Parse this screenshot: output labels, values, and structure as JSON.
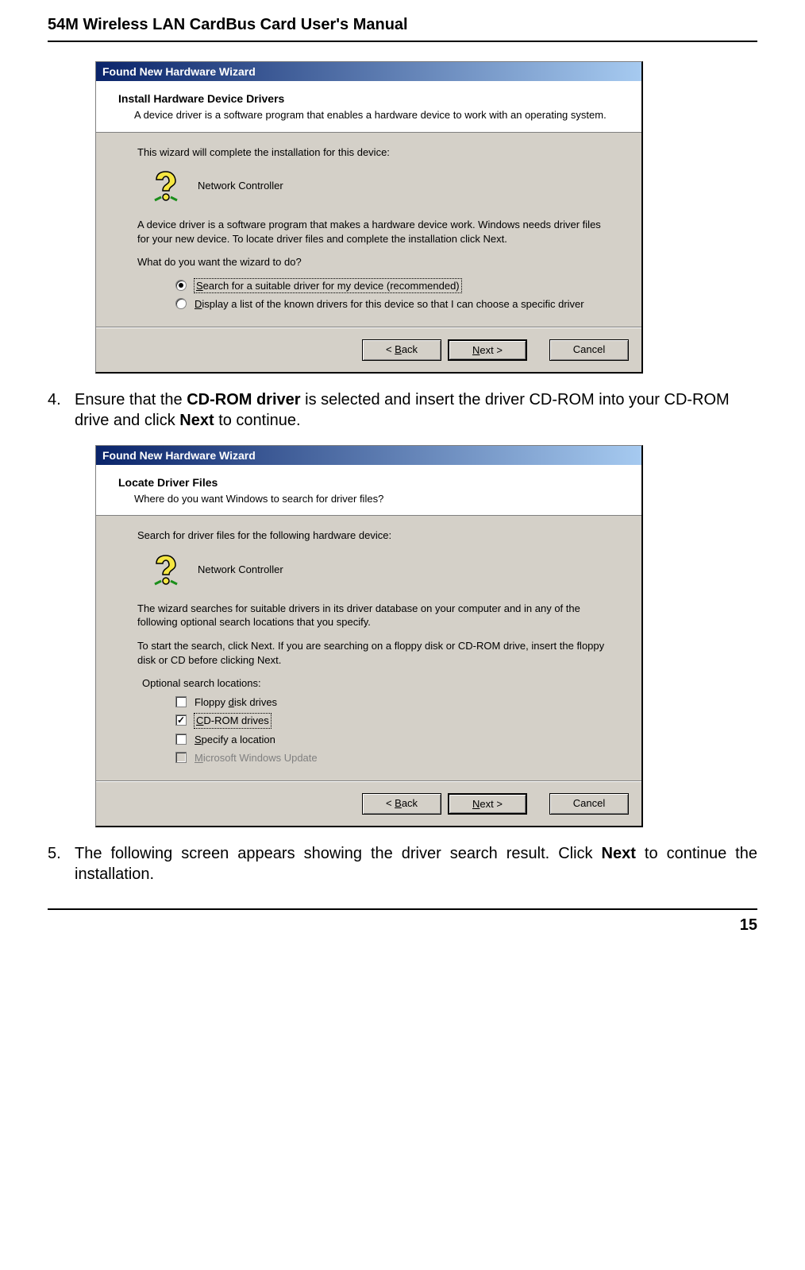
{
  "doc": {
    "header": "54M Wireless LAN CardBus Card User's Manual",
    "page_number": "15"
  },
  "step4": {
    "num": "4.",
    "pre": "Ensure that the ",
    "bold1": "CD-ROM driver",
    "mid": " is selected and insert the driver CD-ROM into your CD-ROM drive and click ",
    "bold2": "Next",
    "post": " to continue."
  },
  "step5": {
    "num": "5.",
    "pre": "The following screen appears showing the driver search result. Click ",
    "bold1": "Next",
    "post": " to continue the installation."
  },
  "dialog1": {
    "title": "Found New Hardware Wizard",
    "heading": "Install Hardware Device Drivers",
    "sub": "A device driver is a software program that enables a hardware device to work with an operating system.",
    "intro": "This wizard will complete the installation for this device:",
    "device": "Network Controller",
    "desc": "A device driver is a software program that makes a hardware device work. Windows needs driver files for your new device. To locate driver files and complete the installation click Next.",
    "prompt": "What do you want the wizard to do?",
    "opt1_accel": "S",
    "opt1_rest": "earch for a suitable driver for my device (recommended)",
    "opt2_accel": "D",
    "opt2_rest": "isplay a list of the known drivers for this device so that I can choose a specific driver",
    "btn_back_lt": "< ",
    "btn_back_accel": "B",
    "btn_back_rest": "ack",
    "btn_next_accel": "N",
    "btn_next_rest": "ext >",
    "btn_cancel": "Cancel"
  },
  "dialog2": {
    "title": "Found New Hardware Wizard",
    "heading": "Locate Driver Files",
    "sub": "Where do you want Windows to search for driver files?",
    "intro": "Search for driver files for the following hardware device:",
    "device": "Network Controller",
    "desc1": "The wizard searches for suitable drivers in its driver database on your computer and in any of the following optional search locations that you specify.",
    "desc2": "To start the search, click Next. If you are searching on a floppy disk or CD-ROM drive, insert the floppy disk or CD before clicking Next.",
    "opt_label": "Optional search locations:",
    "chk1_pre": "Floppy ",
    "chk1_accel": "d",
    "chk1_post": "isk drives",
    "chk2_accel": "C",
    "chk2_post": "D-ROM drives",
    "chk3_accel": "S",
    "chk3_post": "pecify a location",
    "chk4_accel": "M",
    "chk4_post": "icrosoft Windows Update",
    "btn_back_lt": "< ",
    "btn_back_accel": "B",
    "btn_back_rest": "ack",
    "btn_next_accel": "N",
    "btn_next_rest": "ext >",
    "btn_cancel": "Cancel"
  }
}
